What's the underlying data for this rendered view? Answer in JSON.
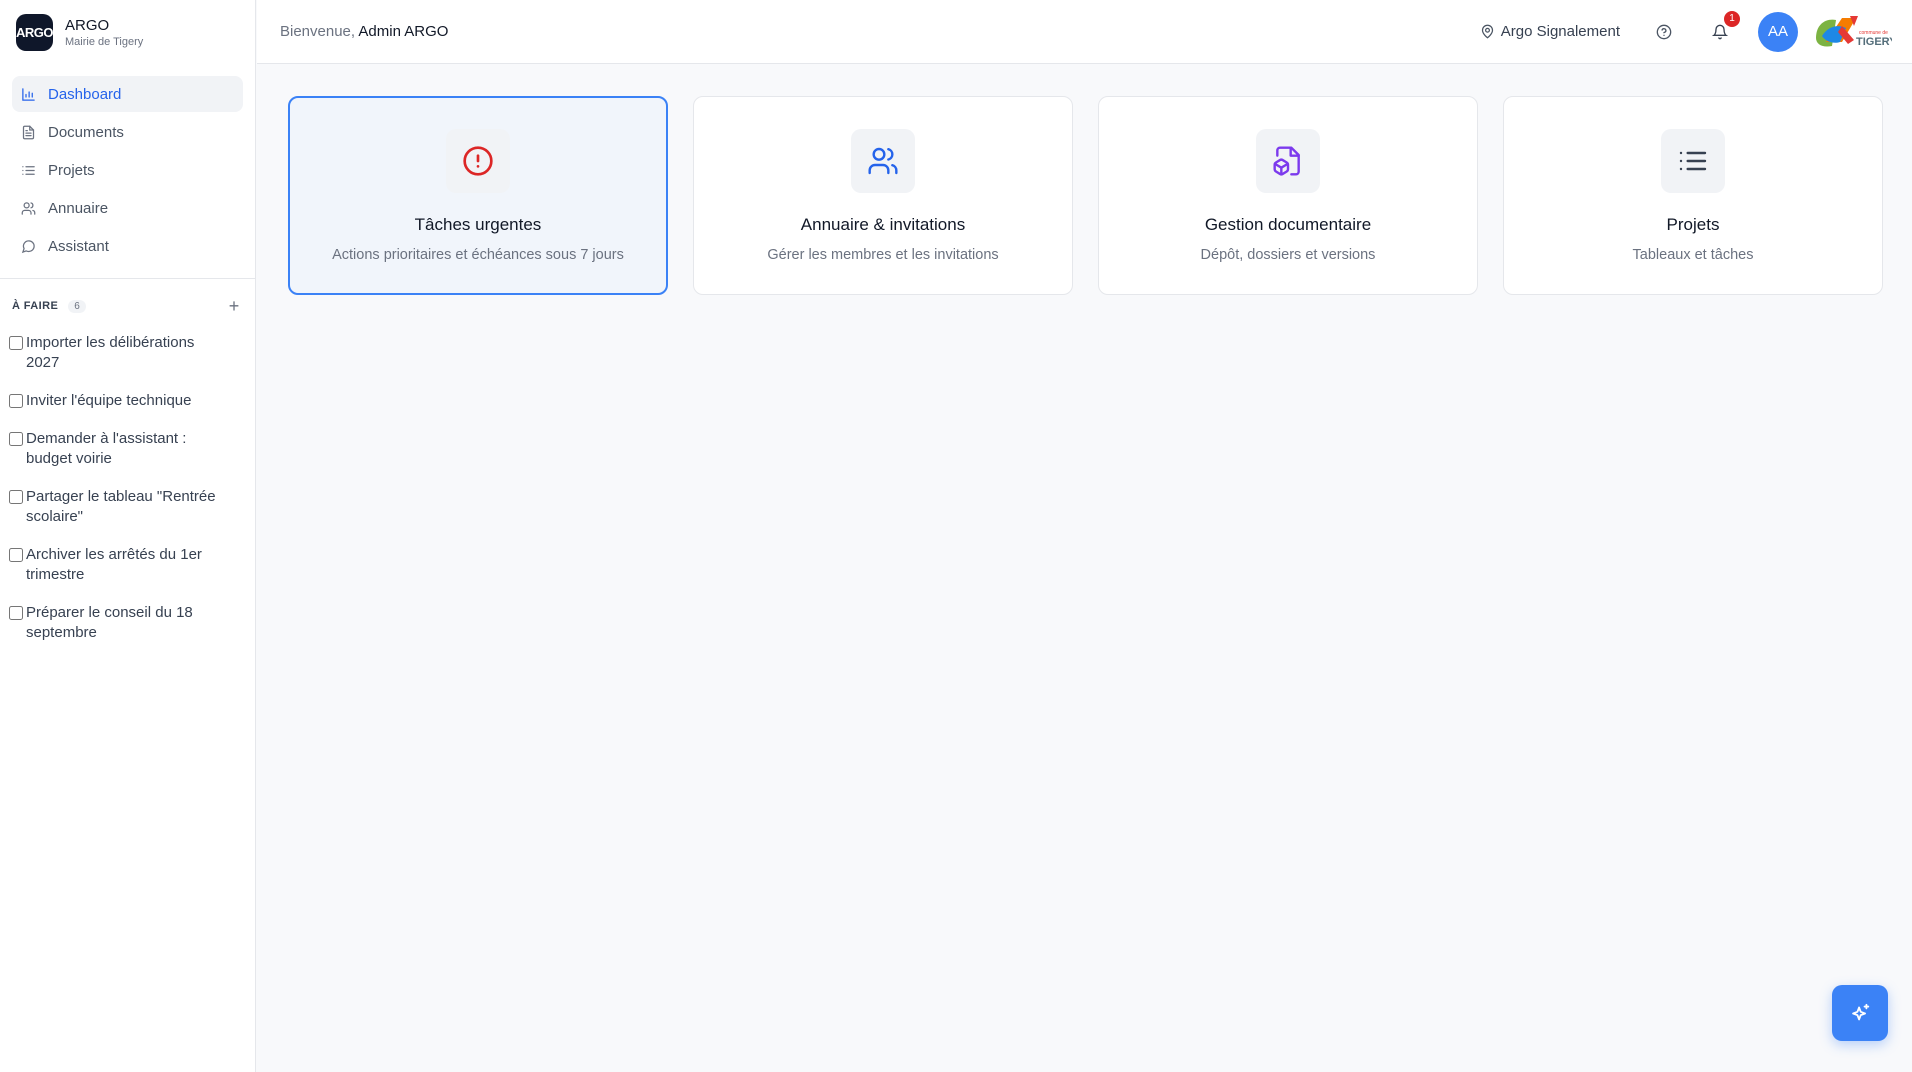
{
  "brand": {
    "logo_text": "ARGO",
    "name": "ARGO",
    "subtitle": "Mairie de Tigery"
  },
  "nav": {
    "items": [
      {
        "label": "Dashboard",
        "icon": "bar-chart-icon",
        "active": true
      },
      {
        "label": "Documents",
        "icon": "document-icon"
      },
      {
        "label": "Projets",
        "icon": "list-icon"
      },
      {
        "label": "Annuaire",
        "icon": "users-icon"
      },
      {
        "label": "Assistant",
        "icon": "chat-icon"
      }
    ]
  },
  "todo": {
    "title": "À FAIRE",
    "count": "6",
    "add_label": "+",
    "items": [
      {
        "label": "Importer les délibérations 2027",
        "checked": false
      },
      {
        "label": "Inviter l'équipe technique",
        "checked": false
      },
      {
        "label": "Demander à l'assistant : budget voirie",
        "checked": false
      },
      {
        "label": "Partager le tableau \"Rentrée scolaire\"",
        "checked": false
      },
      {
        "label": "Archiver les arrêtés du 1er trimestre",
        "checked": false
      },
      {
        "label": "Préparer le conseil du 18 septembre",
        "checked": false
      }
    ]
  },
  "header": {
    "welcome_prefix": "Bienvenue,",
    "user_name": "Admin ARGO",
    "location": "Argo Signalement",
    "notification_count": "1",
    "avatar_initials": "AA",
    "city_logo_text_top": "commune de",
    "city_logo_text": "TIGERY"
  },
  "cards": [
    {
      "title": "Tâches urgentes",
      "description": "Actions prioritaires et échéances sous 7 jours",
      "icon": "alert-circle-icon",
      "icon_color": "#dc2626",
      "selected": true
    },
    {
      "title": "Annuaire & invitations",
      "description": "Gérer les membres et les invitations",
      "icon": "users-icon",
      "icon_color": "#2563eb"
    },
    {
      "title": "Gestion documentaire",
      "description": "Dépôt, dossiers et versions",
      "icon": "file-box-icon",
      "icon_color": "#7c3aed"
    },
    {
      "title": "Projets",
      "description": "Tableaux et tâches",
      "icon": "list-icon",
      "icon_color": "#374151"
    }
  ],
  "colors": {
    "accent": "#3b82f6",
    "active_nav": "#2563eb",
    "badge": "#dc2626"
  },
  "fab": {
    "icon": "sparkles-icon"
  }
}
